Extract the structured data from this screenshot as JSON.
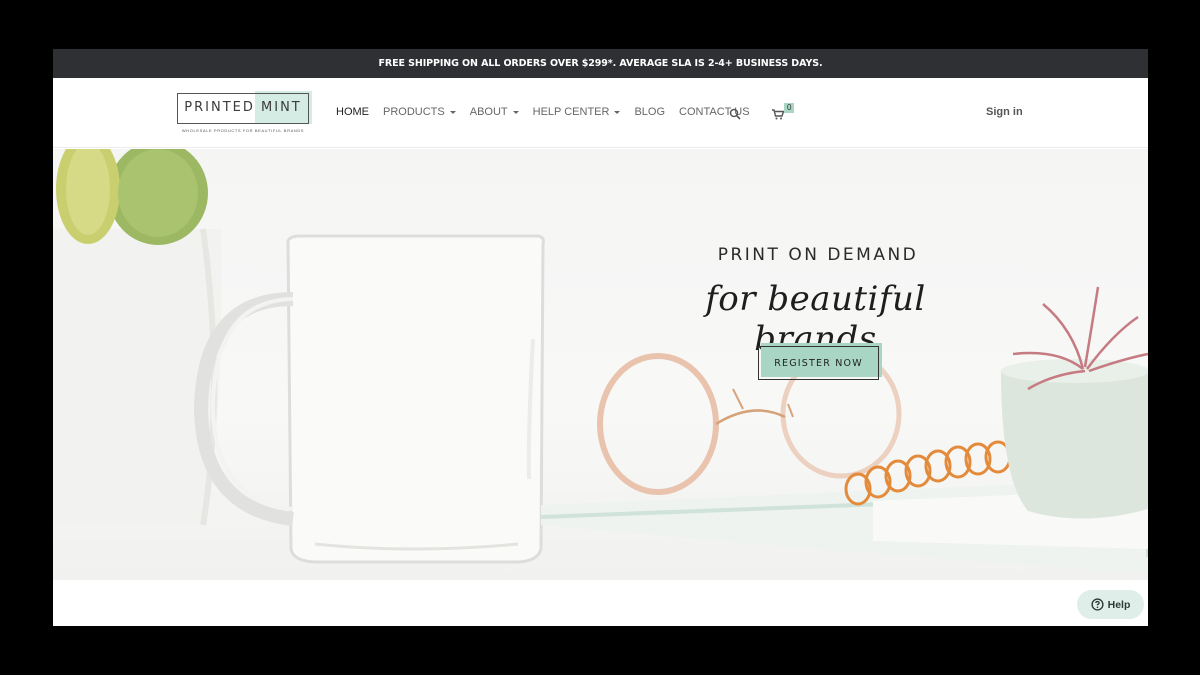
{
  "promo": {
    "text": "FREE SHIPPING ON ALL ORDERS OVER $299*. AVERAGE SLA IS 2-4+ BUSINESS DAYS."
  },
  "brand": {
    "name_part1": "PRINTED",
    "name_part2": "MINT",
    "tagline": "wholesale products for beautiful brands",
    "accent": "#a8d5c4"
  },
  "nav": {
    "items": [
      {
        "label": "HOME",
        "dropdown": false,
        "active": true
      },
      {
        "label": "PRODUCTS",
        "dropdown": true
      },
      {
        "label": "ABOUT",
        "dropdown": true
      },
      {
        "label": "HELP CENTER",
        "dropdown": true
      },
      {
        "label": "BLOG",
        "dropdown": false
      },
      {
        "label": "CONTACT US",
        "dropdown": false
      }
    ],
    "search_icon": "search-icon",
    "cart_icon": "cart-icon",
    "cart_count": "0",
    "sign_in": "Sign in"
  },
  "hero": {
    "title": "PRINT ON DEMAND",
    "script": "for beautiful brands",
    "cta": "REGISTER NOW"
  },
  "help": {
    "label": "Help",
    "icon": "question-circle-icon"
  }
}
